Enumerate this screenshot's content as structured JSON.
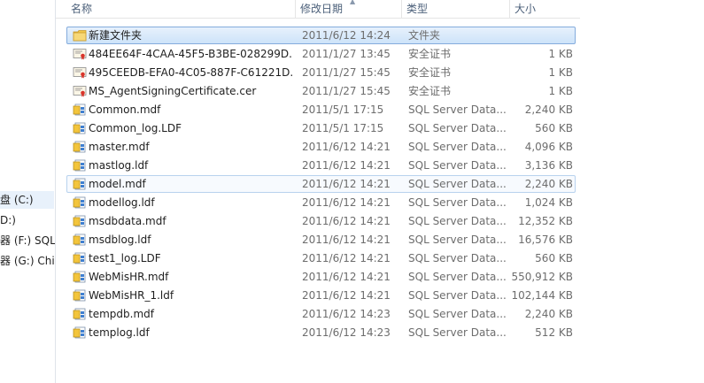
{
  "nav": {
    "items": [
      {
        "label": "盘 (C:)",
        "selected": true
      },
      {
        "label": "D:)",
        "selected": false
      },
      {
        "label": "器 (F:) SQL",
        "selected": false
      },
      {
        "label": "器 (G:) Chi",
        "selected": false
      }
    ]
  },
  "columns": {
    "name": "名称",
    "date": "修改日期",
    "type": "类型",
    "size": "大小"
  },
  "files": [
    {
      "name": "新建文件夹",
      "date": "2011/6/12 14:24",
      "type": "文件夹",
      "size": "",
      "icon": "folder-icon",
      "state": "selected"
    },
    {
      "name": "484EE64F-4CAA-45F5-B3BE-028299D...",
      "date": "2011/1/27 13:45",
      "type": "安全证书",
      "size": "1 KB",
      "icon": "certificate-icon",
      "state": ""
    },
    {
      "name": "495CEEDB-EFA0-4C05-887F-C61221D...",
      "date": "2011/1/27 15:45",
      "type": "安全证书",
      "size": "1 KB",
      "icon": "certificate-icon",
      "state": ""
    },
    {
      "name": "MS_AgentSigningCertificate.cer",
      "date": "2011/1/27 15:45",
      "type": "安全证书",
      "size": "1 KB",
      "icon": "certificate-icon",
      "state": ""
    },
    {
      "name": "Common.mdf",
      "date": "2011/5/1 17:15",
      "type": "SQL Server Data...",
      "size": "2,240 KB",
      "icon": "sql-data-file-icon",
      "state": ""
    },
    {
      "name": "Common_log.LDF",
      "date": "2011/5/1 17:15",
      "type": "SQL Server Data...",
      "size": "560 KB",
      "icon": "sql-data-file-icon",
      "state": ""
    },
    {
      "name": "master.mdf",
      "date": "2011/6/12 14:21",
      "type": "SQL Server Data...",
      "size": "4,096 KB",
      "icon": "sql-data-file-icon",
      "state": ""
    },
    {
      "name": "mastlog.ldf",
      "date": "2011/6/12 14:21",
      "type": "SQL Server Data...",
      "size": "3,136 KB",
      "icon": "sql-data-file-icon",
      "state": ""
    },
    {
      "name": "model.mdf",
      "date": "2011/6/12 14:21",
      "type": "SQL Server Data...",
      "size": "2,240 KB",
      "icon": "sql-data-file-icon",
      "state": "hover"
    },
    {
      "name": "modellog.ldf",
      "date": "2011/6/12 14:21",
      "type": "SQL Server Data...",
      "size": "1,024 KB",
      "icon": "sql-data-file-icon",
      "state": ""
    },
    {
      "name": "msdbdata.mdf",
      "date": "2011/6/12 14:21",
      "type": "SQL Server Data...",
      "size": "12,352 KB",
      "icon": "sql-data-file-icon",
      "state": ""
    },
    {
      "name": "msdblog.ldf",
      "date": "2011/6/12 14:21",
      "type": "SQL Server Data...",
      "size": "16,576 KB",
      "icon": "sql-data-file-icon",
      "state": ""
    },
    {
      "name": "test1_log.LDF",
      "date": "2011/6/12 14:21",
      "type": "SQL Server Data...",
      "size": "560 KB",
      "icon": "sql-data-file-icon",
      "state": ""
    },
    {
      "name": "WebMisHR.mdf",
      "date": "2011/6/12 14:21",
      "type": "SQL Server Data...",
      "size": "550,912 KB",
      "icon": "sql-data-file-icon",
      "state": ""
    },
    {
      "name": "WebMisHR_1.ldf",
      "date": "2011/6/12 14:21",
      "type": "SQL Server Data...",
      "size": "102,144 KB",
      "icon": "sql-data-file-icon",
      "state": ""
    },
    {
      "name": "tempdb.mdf",
      "date": "2011/6/12 14:23",
      "type": "SQL Server Data...",
      "size": "2,240 KB",
      "icon": "sql-data-file-icon",
      "state": ""
    },
    {
      "name": "templog.ldf",
      "date": "2011/6/12 14:23",
      "type": "SQL Server Data...",
      "size": "512 KB",
      "icon": "sql-data-file-icon",
      "state": ""
    }
  ]
}
